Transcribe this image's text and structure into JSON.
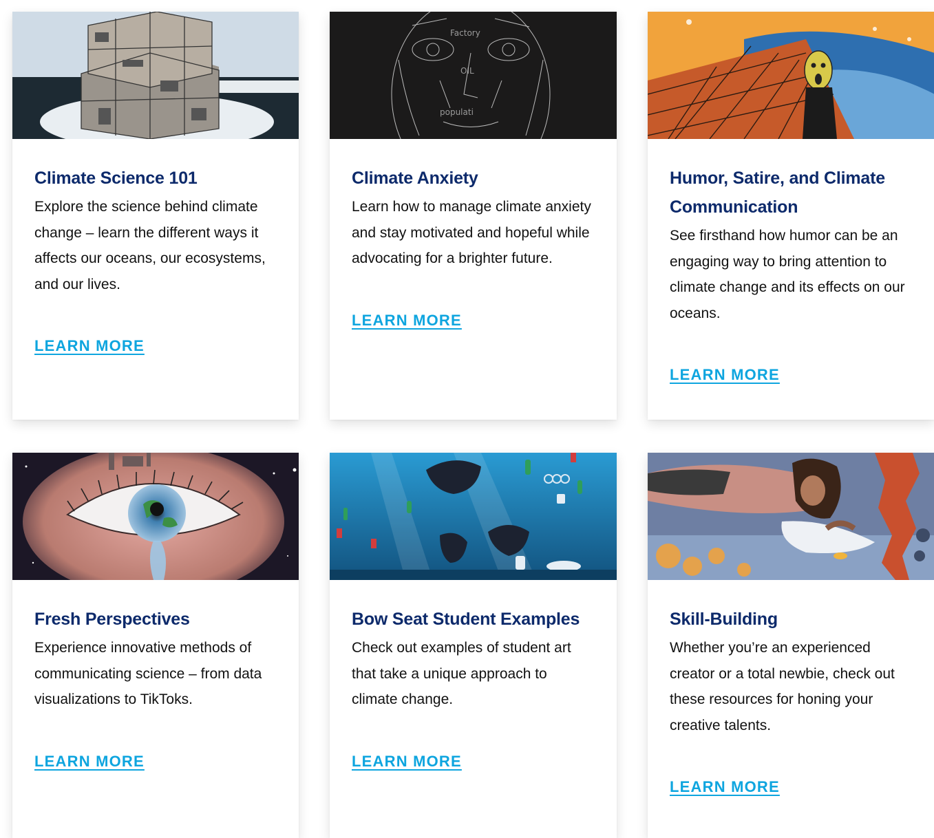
{
  "cards": [
    {
      "title": "Climate Science 101",
      "description": "Explore the science behind climate change – learn the different ways it affects our oceans, our ecosystems, and our lives.",
      "link": "LEARN MORE",
      "image": "cube-city-artwork"
    },
    {
      "title": "Climate Anxiety",
      "description": "Learn how to manage climate anxiety and stay motivated and hopeful while advocating for a brighter future.",
      "link": "LEARN MORE",
      "image": "chalk-face-artwork"
    },
    {
      "title": "Humor, Satire, and Climate Communication",
      "description": "See firsthand how humor can be an engaging way to bring attention to climate change and its effects on our oceans.",
      "link": "LEARN MORE",
      "image": "scream-parody-artwork"
    },
    {
      "title": "Fresh Perspectives",
      "description": "Experience innovative methods of communicating science – from data visualizations to TikToks.",
      "link": "LEARN MORE",
      "image": "earth-eye-artwork"
    },
    {
      "title": "Bow Seat Student Examples",
      "description": "Check out examples of student art that take a unique approach to climate change.",
      "link": "LEARN MORE",
      "image": "ocean-plastic-artwork"
    },
    {
      "title": "Skill-Building",
      "description": "Whether you’re an experienced creator or a total newbie, check out these resources for honing your creative talents.",
      "link": "LEARN MORE",
      "image": "reef-drawing-artwork"
    }
  ],
  "colors": {
    "title": "#0d2a6b",
    "link": "#0ea5df",
    "text": "#111111"
  }
}
